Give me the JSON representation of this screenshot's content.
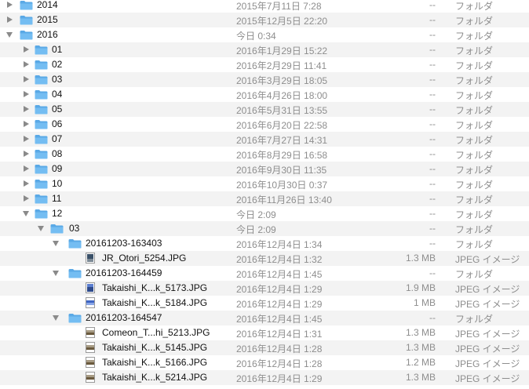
{
  "rows": [
    {
      "name": "2014",
      "date": "2015年7月11日 7:28",
      "size": "--",
      "kind": "フォルダ",
      "level": 0,
      "type": "folder",
      "expanded": false
    },
    {
      "name": "2015",
      "date": "2015年12月5日 22:20",
      "size": "--",
      "kind": "フォルダ",
      "level": 0,
      "type": "folder",
      "expanded": false
    },
    {
      "name": "2016",
      "date": "今日 0:34",
      "size": "--",
      "kind": "フォルダ",
      "level": 0,
      "type": "folder",
      "expanded": true
    },
    {
      "name": "01",
      "date": "2016年1月29日 15:22",
      "size": "--",
      "kind": "フォルダ",
      "level": 1,
      "type": "folder",
      "expanded": false
    },
    {
      "name": "02",
      "date": "2016年2月29日 11:41",
      "size": "--",
      "kind": "フォルダ",
      "level": 1,
      "type": "folder",
      "expanded": false
    },
    {
      "name": "03",
      "date": "2016年3月29日 18:05",
      "size": "--",
      "kind": "フォルダ",
      "level": 1,
      "type": "folder",
      "expanded": false
    },
    {
      "name": "04",
      "date": "2016年4月26日 18:00",
      "size": "--",
      "kind": "フォルダ",
      "level": 1,
      "type": "folder",
      "expanded": false
    },
    {
      "name": "05",
      "date": "2016年5月31日 13:55",
      "size": "--",
      "kind": "フォルダ",
      "level": 1,
      "type": "folder",
      "expanded": false
    },
    {
      "name": "06",
      "date": "2016年6月20日 22:58",
      "size": "--",
      "kind": "フォルダ",
      "level": 1,
      "type": "folder",
      "expanded": false
    },
    {
      "name": "07",
      "date": "2016年7月27日 14:31",
      "size": "--",
      "kind": "フォルダ",
      "level": 1,
      "type": "folder",
      "expanded": false
    },
    {
      "name": "08",
      "date": "2016年8月29日 16:58",
      "size": "--",
      "kind": "フォルダ",
      "level": 1,
      "type": "folder",
      "expanded": false
    },
    {
      "name": "09",
      "date": "2016年9月30日 11:35",
      "size": "--",
      "kind": "フォルダ",
      "level": 1,
      "type": "folder",
      "expanded": false
    },
    {
      "name": "10",
      "date": "2016年10月30日 0:37",
      "size": "--",
      "kind": "フォルダ",
      "level": 1,
      "type": "folder",
      "expanded": false
    },
    {
      "name": "11",
      "date": "2016年11月26日 13:40",
      "size": "--",
      "kind": "フォルダ",
      "level": 1,
      "type": "folder",
      "expanded": false
    },
    {
      "name": "12",
      "date": "今日 2:09",
      "size": "--",
      "kind": "フォルダ",
      "level": 1,
      "type": "folder",
      "expanded": true
    },
    {
      "name": "03",
      "date": "今日 2:09",
      "size": "--",
      "kind": "フォルダ",
      "level": 2,
      "type": "folder",
      "expanded": true
    },
    {
      "name": "20161203-163403",
      "date": "2016年12月4日 1:34",
      "size": "--",
      "kind": "フォルダ",
      "level": 3,
      "type": "folder",
      "expanded": true
    },
    {
      "name": "JR_Otori_5254.JPG",
      "date": "2016年12月4日 1:32",
      "size": "1.3 MB",
      "kind": "JPEG イメージ",
      "level": 4,
      "type": "file",
      "thumb": "portrait"
    },
    {
      "name": "20161203-164459",
      "date": "2016年12月4日 1:45",
      "size": "--",
      "kind": "フォルダ",
      "level": 3,
      "type": "folder",
      "expanded": true
    },
    {
      "name": "Takaishi_K...k_5173.JPG",
      "date": "2016年12月4日 1:29",
      "size": "1.9 MB",
      "kind": "JPEG イメージ",
      "level": 4,
      "type": "file",
      "thumb": "portrait-blue"
    },
    {
      "name": "Takaishi_K...k_5184.JPG",
      "date": "2016年12月4日 1:29",
      "size": "1 MB",
      "kind": "JPEG イメージ",
      "level": 4,
      "type": "file",
      "thumb": "landscape-blue"
    },
    {
      "name": "20161203-164547",
      "date": "2016年12月4日 1:45",
      "size": "--",
      "kind": "フォルダ",
      "level": 3,
      "type": "folder",
      "expanded": true
    },
    {
      "name": "Comeon_T...hi_5213.JPG",
      "date": "2016年12月4日 1:31",
      "size": "1.3 MB",
      "kind": "JPEG イメージ",
      "level": 4,
      "type": "file",
      "thumb": "landscape"
    },
    {
      "name": "Takaishi_K...k_5145.JPG",
      "date": "2016年12月4日 1:28",
      "size": "1.3 MB",
      "kind": "JPEG イメージ",
      "level": 4,
      "type": "file",
      "thumb": "landscape"
    },
    {
      "name": "Takaishi_K...k_5166.JPG",
      "date": "2016年12月4日 1:28",
      "size": "1.2 MB",
      "kind": "JPEG イメージ",
      "level": 4,
      "type": "file",
      "thumb": "landscape"
    },
    {
      "name": "Takaishi_K...k_5214.JPG",
      "date": "2016年12月4日 1:29",
      "size": "1.3 MB",
      "kind": "JPEG イメージ",
      "level": 4,
      "type": "file",
      "thumb": "landscape"
    }
  ],
  "colors": {
    "folder_body": "#74bdf2",
    "folder_tab": "#5aa9e6",
    "row_alt": "#f3f3f3",
    "secondary_text": "#8e8e8e"
  }
}
